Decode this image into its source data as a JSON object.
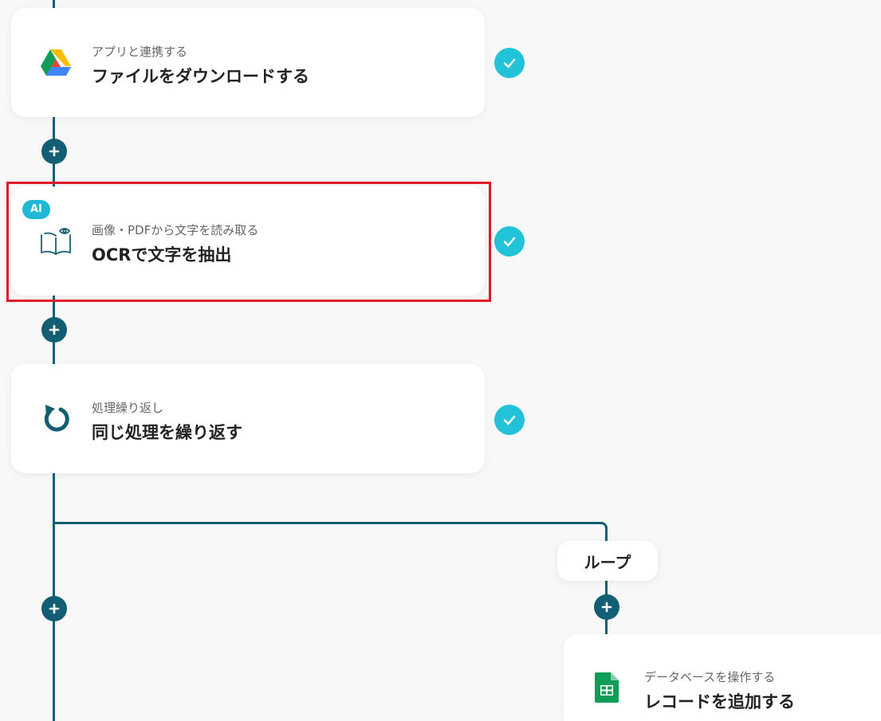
{
  "colors": {
    "wire": "#125f74",
    "check": "#22c3d9",
    "ai_badge": "#1fb8d6",
    "highlight": "#e11a2a",
    "background": "#f8f8f8"
  },
  "steps": [
    {
      "icon": "google-drive-icon",
      "subtitle": "アプリと連携する",
      "title": "ファイルをダウンロードする",
      "status": "completed"
    },
    {
      "icon": "ocr-book-eye-icon",
      "badge": "AI",
      "subtitle": "画像・PDFから文字を読み取る",
      "title": "OCRで文字を抽出",
      "status": "completed",
      "highlighted": true
    },
    {
      "icon": "loop-arrow-icon",
      "subtitle": "処理繰り返し",
      "title": "同じ処理を繰り返す",
      "status": "completed"
    }
  ],
  "branch": {
    "label": "ループ",
    "step": {
      "icon": "google-sheets-icon",
      "subtitle": "データベースを操作する",
      "title": "レコードを追加する"
    }
  },
  "add_button_icon": "plus-icon",
  "check_icon": "check-icon"
}
